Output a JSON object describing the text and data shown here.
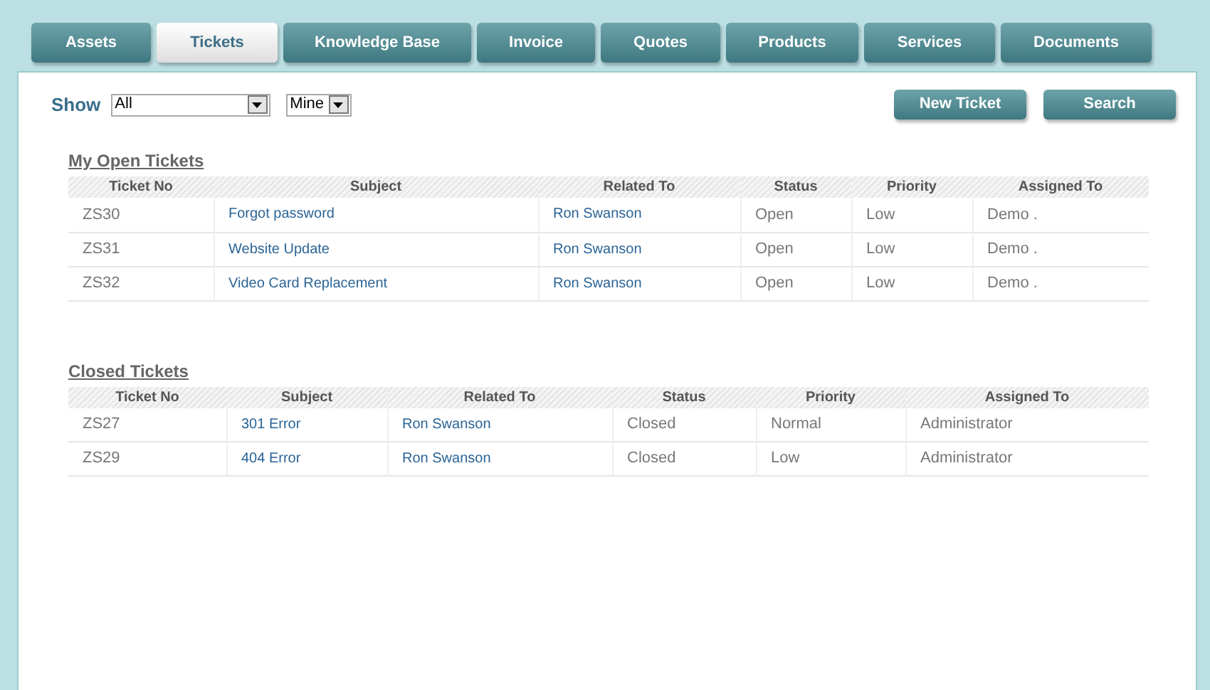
{
  "tabs": [
    {
      "label": "Assets",
      "selected": false
    },
    {
      "label": "Tickets",
      "selected": true
    },
    {
      "label": "Knowledge Base",
      "selected": false
    },
    {
      "label": "Invoice",
      "selected": false
    },
    {
      "label": "Quotes",
      "selected": false
    },
    {
      "label": "Products",
      "selected": false
    },
    {
      "label": "Services",
      "selected": false
    },
    {
      "label": "Documents",
      "selected": false
    }
  ],
  "filter": {
    "label": "Show",
    "scope": "All",
    "owner": "Mine"
  },
  "buttons": [
    "New Ticket",
    "Search"
  ],
  "sections": [
    {
      "title": "My Open Tickets",
      "columns": [
        {
          "label": "Ticket No",
          "kind": "text"
        },
        {
          "label": "Subject",
          "kind": "link"
        },
        {
          "label": "Related To",
          "kind": "link"
        },
        {
          "label": "Status",
          "kind": "text"
        },
        {
          "label": "Priority",
          "kind": "text"
        },
        {
          "label": "Assigned To",
          "kind": "text"
        }
      ],
      "rows": [
        [
          "ZS30",
          "Forgot password",
          "Ron Swanson",
          "Open",
          "Low",
          "Demo ."
        ],
        [
          "ZS31",
          "Website Update",
          "Ron Swanson",
          "Open",
          "Low",
          "Demo ."
        ],
        [
          "ZS32",
          "Video Card Replacement",
          "Ron Swanson",
          "Open",
          "Low",
          "Demo ."
        ]
      ]
    },
    {
      "title": "Closed Tickets",
      "columns": [
        {
          "label": "Ticket No",
          "kind": "text"
        },
        {
          "label": "Subject",
          "kind": "link"
        },
        {
          "label": "Related To",
          "kind": "link"
        },
        {
          "label": "Status",
          "kind": "text"
        },
        {
          "label": "Priority",
          "kind": "text"
        },
        {
          "label": "Assigned To",
          "kind": "text"
        }
      ],
      "rows": [
        [
          "ZS27",
          "301 Error",
          "Ron Swanson",
          "Closed",
          "Normal",
          "Administrator"
        ],
        [
          "ZS29",
          "404 Error",
          "Ron Swanson",
          "Closed",
          "Low",
          "Administrator"
        ]
      ]
    }
  ]
}
